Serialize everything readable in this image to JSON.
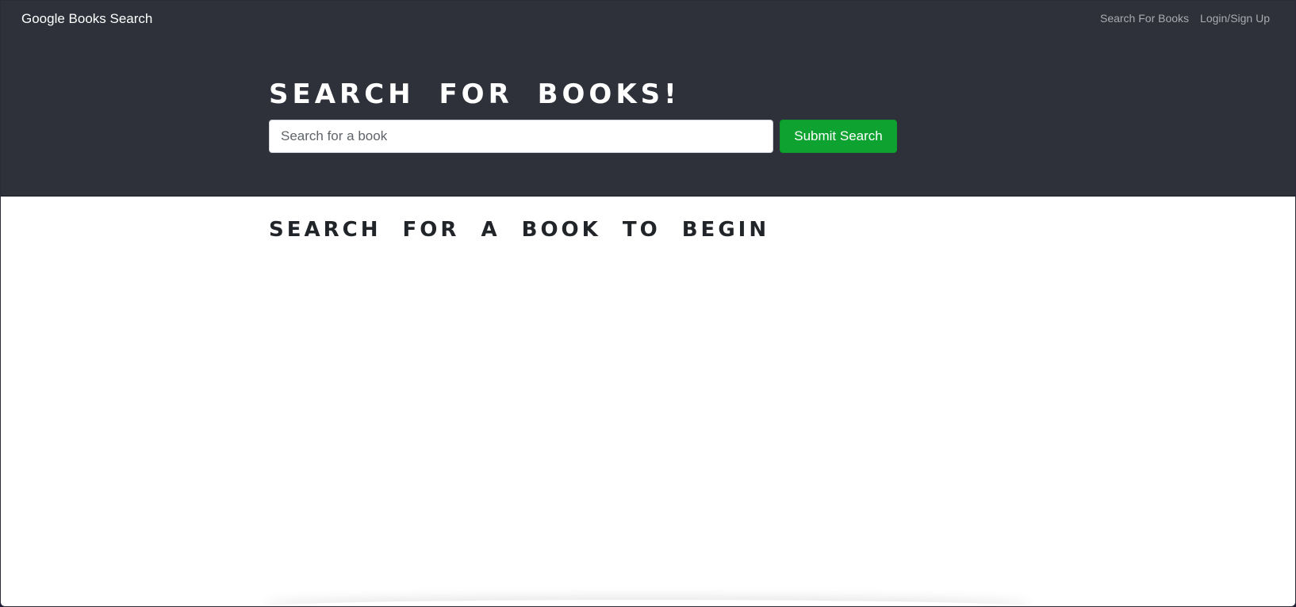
{
  "navbar": {
    "brand": "Google Books Search",
    "links": [
      "Search For Books",
      "Login/Sign Up"
    ]
  },
  "hero": {
    "title": "SEARCH FOR BOOKS!",
    "search": {
      "placeholder": "Search for a book",
      "value": ""
    },
    "submit_label": "Submit Search"
  },
  "main": {
    "heading": "SEARCH FOR A BOOK TO BEGIN"
  },
  "colors": {
    "header_bg": "#2e313a",
    "submit_bg": "#0ea330",
    "page_bg": "#ffffff"
  }
}
